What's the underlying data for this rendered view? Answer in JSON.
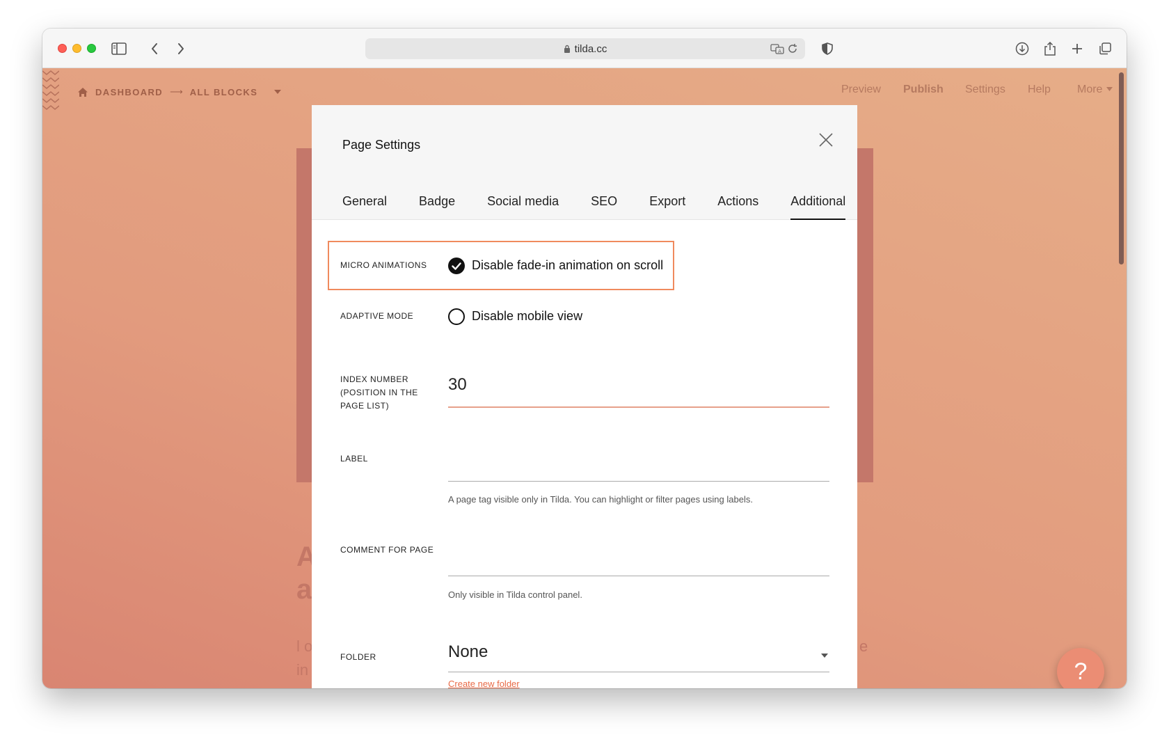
{
  "browser": {
    "url": "tilda.cc",
    "icons": [
      "sidebar-icon",
      "back-icon",
      "forward-icon",
      "lock-icon",
      "translate-icon",
      "reload-icon",
      "shield-icon",
      "download-icon",
      "share-icon",
      "new-tab-icon",
      "tabs-overview-icon"
    ]
  },
  "editor": {
    "breadcrumb": {
      "home_icon": "home-icon",
      "dashboard": "DASHBOARD",
      "separator": "⟶",
      "all_blocks": "ALL BLOCKS"
    },
    "menu": {
      "preview": "Preview",
      "publish": "Publish",
      "settings": "Settings",
      "help": "Help",
      "more": "More"
    },
    "background_heading_partial": [
      "A",
      "a"
    ],
    "background_text_partial": [
      "l o",
      "in",
      "e"
    ],
    "help_button": "?"
  },
  "modal": {
    "title": "Page Settings",
    "tabs": [
      {
        "label": "General"
      },
      {
        "label": "Badge"
      },
      {
        "label": "Social media"
      },
      {
        "label": "SEO"
      },
      {
        "label": "Export"
      },
      {
        "label": "Actions"
      },
      {
        "label": "Additional",
        "active": true
      }
    ],
    "micro_animations": {
      "label": "MICRO ANIMATIONS",
      "option": "Disable fade-in animation on scroll",
      "checked": true
    },
    "adaptive_mode": {
      "label": "ADAPTIVE MODE",
      "option": "Disable mobile view",
      "checked": false
    },
    "index_number": {
      "label_lines": [
        "INDEX NUMBER",
        "(POSITION IN THE",
        "PAGE LIST)"
      ],
      "value": "30"
    },
    "label_field": {
      "label": "LABEL",
      "value": "",
      "hint": "A page tag visible only in Tilda. You can highlight or filter pages using labels."
    },
    "comment": {
      "label": "COMMENT FOR PAGE",
      "value": "",
      "hint": "Only visible in Tilda control panel."
    },
    "folder": {
      "label": "FOLDER",
      "selected": "None",
      "create_link": "Create new folder"
    }
  },
  "colors": {
    "highlight_border": "#f08a5d",
    "accent": "#e86a46",
    "background_gradient_start": "#d98572",
    "background_gradient_end": "#e6ad88"
  }
}
